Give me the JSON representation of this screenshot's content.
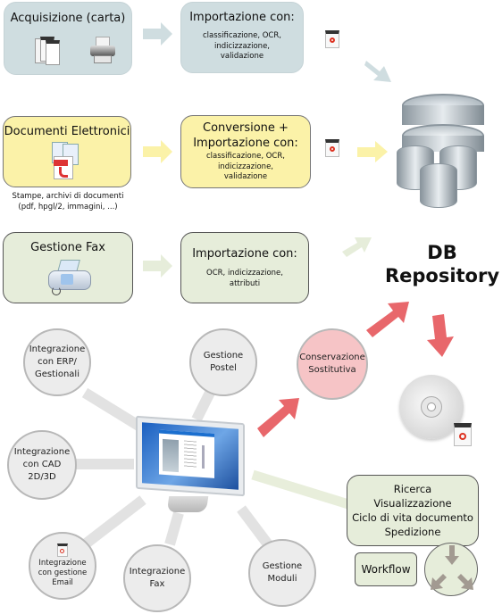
{
  "row1": {
    "source": {
      "title": "Acquisizione (carta)",
      "icons": [
        "documents-icon",
        "printer-icon"
      ]
    },
    "process": {
      "title": "Importazione con:",
      "details": [
        "classificazione, OCR,",
        "indicizzazione,",
        "validazione"
      ]
    }
  },
  "row2": {
    "source": {
      "title": "Documenti Elettronici",
      "caption": [
        "Stampe, archivi di documenti",
        "(pdf, hpgl/2, immagini, ...)"
      ],
      "icons": [
        "pdf-documents-icon"
      ]
    },
    "process": {
      "title": [
        "Conversione  +",
        "Importazione con:"
      ],
      "details": [
        "classificazione, OCR,",
        "indicizzazione,",
        "validazione"
      ]
    }
  },
  "row3": {
    "source": {
      "title": "Gestione Fax",
      "icons": [
        "fax-icon"
      ]
    },
    "process": {
      "title": "Importazione con:",
      "details": [
        "OCR, indicizzazione,",
        "attributi"
      ]
    }
  },
  "repository": {
    "label": [
      "DB",
      "Repository"
    ]
  },
  "conservation": {
    "label": [
      "Conservazione",
      "Sostitutiva"
    ]
  },
  "hub_nodes": [
    {
      "id": "erp",
      "label": [
        "Integrazione",
        "con ERP/",
        "Gestionali"
      ]
    },
    {
      "id": "postel",
      "label": [
        "Gestione",
        "Postel"
      ]
    },
    {
      "id": "cad",
      "label": [
        "Integrazione",
        "con CAD",
        "2D/3D"
      ]
    },
    {
      "id": "email",
      "label": [
        "Integrazione",
        "con gestione",
        "Email"
      ]
    },
    {
      "id": "fax",
      "label": [
        "Integrazione",
        "Fax"
      ]
    },
    {
      "id": "moduli",
      "label": [
        "Gestione",
        "Moduli"
      ]
    }
  ],
  "features": {
    "lines": [
      "Ricerca",
      "Visualizzazione",
      "Ciclo di vita documento",
      "Spedizione"
    ]
  },
  "workflow": {
    "label": "Workflow"
  },
  "colors": {
    "blue_row": "#cfdde0",
    "yellow_row": "#fbf2a8",
    "green_row": "#e6edda",
    "red_arrow": "#e8676b",
    "conservation_fill": "#f6c4c6",
    "workflow_arrow": "#a29a91"
  }
}
